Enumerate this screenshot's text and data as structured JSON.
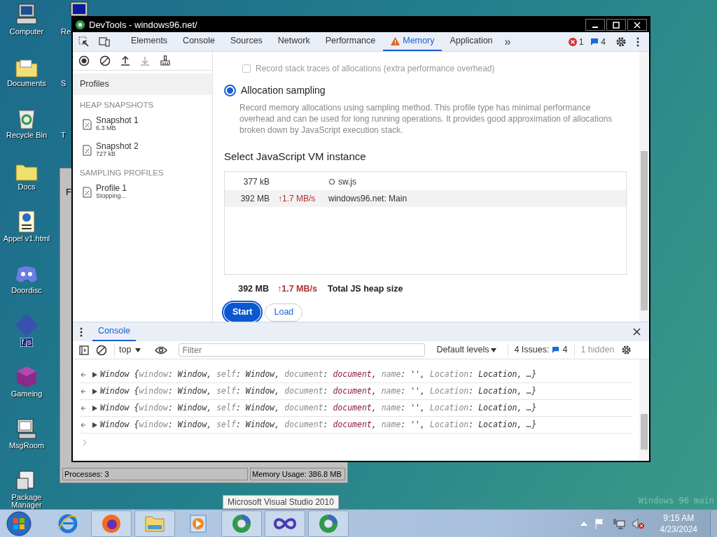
{
  "desktop": {
    "icons": [
      {
        "label": "Computer",
        "kind": "computer",
        "selected": false
      },
      {
        "label": "Documents",
        "kind": "folder-docs",
        "selected": false
      },
      {
        "label": "Recycle Bin",
        "kind": "recycle",
        "selected": false
      },
      {
        "label": "Docs",
        "kind": "folder",
        "selected": false
      },
      {
        "label": "Appel v1.html",
        "kind": "html",
        "selected": false
      },
      {
        "label": "Doordisc",
        "kind": "chat",
        "selected": false
      },
      {
        "label": "f.js",
        "kind": "diamond",
        "selected": true
      },
      {
        "label": "Gameing",
        "kind": "cube",
        "selected": false
      },
      {
        "label": "MsgRoom",
        "kind": "msg",
        "selected": false
      },
      {
        "label": "Package Manager",
        "kind": "package",
        "selected": false
      }
    ],
    "partial_labels": [
      "Re",
      "S",
      "T"
    ],
    "os_text": "Windows 96 main"
  },
  "task_manager": {
    "fragment": "F",
    "status_bar": [
      "Processes: 3",
      "Memory Usage: 386.8 MB"
    ]
  },
  "devtools": {
    "title": "DevTools - windows96.net/",
    "tabs": [
      {
        "label": "Elements",
        "selected": false,
        "warning": false
      },
      {
        "label": "Console",
        "selected": false,
        "warning": false
      },
      {
        "label": "Sources",
        "selected": false,
        "warning": false
      },
      {
        "label": "Network",
        "selected": false,
        "warning": false
      },
      {
        "label": "Performance",
        "selected": false,
        "warning": false
      },
      {
        "label": "Memory",
        "selected": true,
        "warning": true
      },
      {
        "label": "Application",
        "selected": false,
        "warning": false
      }
    ],
    "more_tabs": "»",
    "errors": "1",
    "messages": "4",
    "sidebar": {
      "header": {
        "label": "Profiles",
        "selected": true
      },
      "sections": [
        {
          "title": "HEAP SNAPSHOTS",
          "items": [
            {
              "name": "Snapshot 1",
              "detail": "6.3 MB"
            },
            {
              "name": "Snapshot 2",
              "detail": "727 kB"
            }
          ]
        },
        {
          "title": "SAMPLING PROFILES",
          "items": [
            {
              "name": "Profile 1",
              "detail": "Stopping..."
            }
          ]
        }
      ]
    },
    "options": {
      "stack_traces": {
        "label": "Record stack traces of allocations (extra performance overhead)",
        "checked": false,
        "disabled": true
      },
      "sampling": {
        "label": "Allocation sampling",
        "selected": true,
        "description": "Record memory allocations using sampling method. This profile type has minimal performance overhead and can be used for long running operations. It provides good approximation of allocations broken down by JavaScript execution stack."
      }
    },
    "vm_heading": "Select JavaScript VM instance",
    "vm_instances": [
      {
        "size": "377 kB",
        "name": "sw.js",
        "worker": true,
        "selected": false
      },
      {
        "size": "392 MB",
        "rate": "↑1.7 MB/s",
        "name": "windows96.net: Main",
        "worker": false,
        "selected": true
      }
    ],
    "total": {
      "size": "392 MB",
      "rate": "↑1.7 MB/s",
      "label": "Total JS heap size"
    },
    "buttons": {
      "start": "Start",
      "load": "Load"
    },
    "drawer": {
      "tab": "Console",
      "context": "top",
      "filter_placeholder": "Filter",
      "levels": "Default levels",
      "issues": "4 Issues:",
      "issues_count": "4",
      "hidden": "1 hidden",
      "logs": [
        {
          "segments": [
            {
              "text": "Window {",
              "kind": "plain"
            },
            {
              "text": "window",
              "kind": "key"
            },
            {
              "text": ": Window, ",
              "kind": "plain"
            },
            {
              "text": "self",
              "kind": "key"
            },
            {
              "text": ": Window, ",
              "kind": "plain"
            },
            {
              "text": "document",
              "kind": "key"
            },
            {
              "text": ": ",
              "kind": "plain"
            },
            {
              "text": "document",
              "kind": "node"
            },
            {
              "text": ", ",
              "kind": "plain"
            },
            {
              "text": "name",
              "kind": "key"
            },
            {
              "text": ": '', ",
              "kind": "plain"
            },
            {
              "text": "Location",
              "kind": "key"
            },
            {
              "text": ": Location, …}",
              "kind": "plain"
            }
          ]
        },
        {
          "segments": [
            {
              "text": "Window {",
              "kind": "plain"
            },
            {
              "text": "window",
              "kind": "key"
            },
            {
              "text": ": Window, ",
              "kind": "plain"
            },
            {
              "text": "self",
              "kind": "key"
            },
            {
              "text": ": Window, ",
              "kind": "plain"
            },
            {
              "text": "document",
              "kind": "key"
            },
            {
              "text": ": ",
              "kind": "plain"
            },
            {
              "text": "document",
              "kind": "node"
            },
            {
              "text": ", ",
              "kind": "plain"
            },
            {
              "text": "name",
              "kind": "key"
            },
            {
              "text": ": '', ",
              "kind": "plain"
            },
            {
              "text": "Location",
              "kind": "key"
            },
            {
              "text": ": Location, …}",
              "kind": "plain"
            }
          ]
        },
        {
          "segments": [
            {
              "text": "Window {",
              "kind": "plain"
            },
            {
              "text": "window",
              "kind": "key"
            },
            {
              "text": ": Window, ",
              "kind": "plain"
            },
            {
              "text": "self",
              "kind": "key"
            },
            {
              "text": ": Window, ",
              "kind": "plain"
            },
            {
              "text": "document",
              "kind": "key"
            },
            {
              "text": ": ",
              "kind": "plain"
            },
            {
              "text": "document",
              "kind": "node"
            },
            {
              "text": ", ",
              "kind": "plain"
            },
            {
              "text": "name",
              "kind": "key"
            },
            {
              "text": ": '', ",
              "kind": "plain"
            },
            {
              "text": "Location",
              "kind": "key"
            },
            {
              "text": ": Location, …}",
              "kind": "plain"
            }
          ]
        },
        {
          "segments": [
            {
              "text": "Window {",
              "kind": "plain"
            },
            {
              "text": "window",
              "kind": "key"
            },
            {
              "text": ": Window, ",
              "kind": "plain"
            },
            {
              "text": "self",
              "kind": "key"
            },
            {
              "text": ": Window, ",
              "kind": "plain"
            },
            {
              "text": "document",
              "kind": "key"
            },
            {
              "text": ": ",
              "kind": "plain"
            },
            {
              "text": "document",
              "kind": "node"
            },
            {
              "text": ", ",
              "kind": "plain"
            },
            {
              "text": "name",
              "kind": "key"
            },
            {
              "text": ": '', ",
              "kind": "plain"
            },
            {
              "text": "Location",
              "kind": "key"
            },
            {
              "text": ": Location, …}",
              "kind": "plain"
            }
          ]
        }
      ]
    }
  },
  "taskbar": {
    "apps": [
      {
        "kind": "ie",
        "open": false
      },
      {
        "kind": "firefox",
        "open": true
      },
      {
        "kind": "explorer",
        "open": true
      },
      {
        "kind": "media",
        "open": false
      },
      {
        "kind": "chrome",
        "open": true
      },
      {
        "kind": "vs",
        "open": true
      },
      {
        "kind": "chrome",
        "open": true
      }
    ],
    "tooltip": "Microsoft Visual Studio 2010",
    "time": "9:15 AM",
    "date": "4/23/2024"
  }
}
